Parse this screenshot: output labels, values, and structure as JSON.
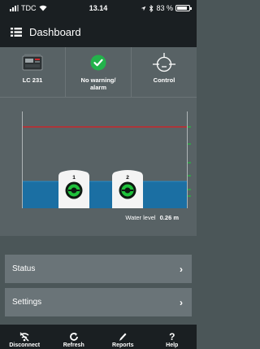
{
  "status_bar": {
    "carrier": "TDC",
    "time": "13.14",
    "battery": "83 %",
    "battery_level": 0.83
  },
  "header": {
    "title": "Dashboard",
    "menu_icon": "hamburger-menu-icon"
  },
  "info": {
    "controller": {
      "label": "LC 231",
      "icon": "controller-device-icon"
    },
    "alarm": {
      "label_line1": "No warning/",
      "label_line2": "alarm",
      "icon": "checkmark-icon",
      "color": "#23b24b"
    },
    "control": {
      "label": "Control",
      "icon": "float-switch-icon"
    }
  },
  "tank": {
    "pumps": [
      {
        "number": "1",
        "icon": "pump-running-icon"
      },
      {
        "number": "2",
        "icon": "pump-running-icon"
      }
    ],
    "water_level_label": "Water level",
    "water_level_value": "0.26 m",
    "alarm_line_color": "#c8282d",
    "water_color": "#1b6fa3",
    "pump_indicator_color": "#1fc23b"
  },
  "menu": {
    "status": "Status",
    "settings": "Settings",
    "chevron": "›"
  },
  "nav": {
    "disconnect": "Disconnect",
    "refresh": "Refresh",
    "reports": "Reports",
    "help": "Help",
    "help_icon": "?"
  }
}
